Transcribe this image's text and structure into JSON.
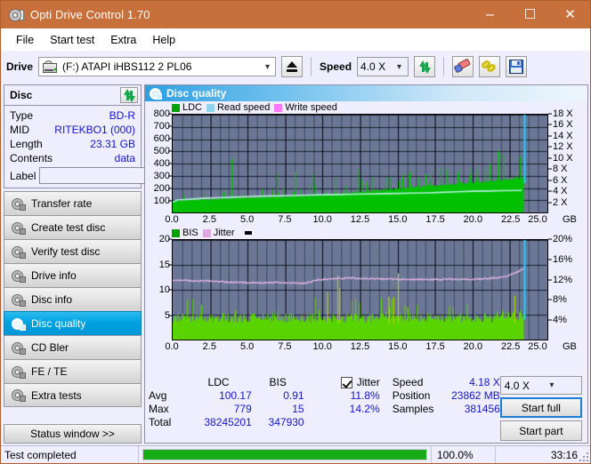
{
  "window": {
    "title": "Opti Drive Control 1.70",
    "icon": "disc-icon",
    "minimize": "–",
    "maximize": "☐",
    "close": "✕"
  },
  "menu": [
    "File",
    "Start test",
    "Extra",
    "Help"
  ],
  "toolbar": {
    "drive_label": "Drive",
    "drive_value": "(F:)   ATAPI iHBS112  2 PL06",
    "eject_title": "Eject",
    "speed_label": "Speed",
    "speed_value": "4.0 X",
    "buttons": [
      "refresh-icon",
      "erase-icon",
      "chain-icon",
      "save-icon"
    ]
  },
  "disc": {
    "title": "Disc",
    "refresh_icon": "refresh-icon",
    "rows": [
      {
        "key": "Type",
        "value": "BD-R"
      },
      {
        "key": "MID",
        "value": "RITEKBO1 (000)"
      },
      {
        "key": "Length",
        "value": "23.31 GB"
      },
      {
        "key": "Contents",
        "value": "data"
      }
    ],
    "label_key": "Label",
    "label_value": "",
    "label_placeholder": "",
    "cd_icon": "cd-icon"
  },
  "nav": {
    "items": [
      {
        "label": "Transfer rate",
        "active": false
      },
      {
        "label": "Create test disc",
        "active": false
      },
      {
        "label": "Verify test disc",
        "active": false
      },
      {
        "label": "Drive info",
        "active": false
      },
      {
        "label": "Disc info",
        "active": false
      },
      {
        "label": "Disc quality",
        "active": true
      },
      {
        "label": "CD Bler",
        "active": false
      },
      {
        "label": "FE / TE",
        "active": false
      },
      {
        "label": "Extra tests",
        "active": false
      }
    ],
    "status_window": "Status window >>"
  },
  "panel": {
    "title": "Disc quality",
    "icon": "disc-quality-icon"
  },
  "chart_data": [
    {
      "type": "area",
      "name": "ldc-chart",
      "title": "",
      "xlabel": "GB",
      "ylabel": "",
      "xlim": [
        0,
        25.0
      ],
      "ylim": [
        0,
        800
      ],
      "y2lim": [
        0,
        18
      ],
      "y2label": "X",
      "grid": true,
      "legend_position": "top-left",
      "legend": [
        {
          "label": "LDC",
          "color": "#00b400"
        },
        {
          "label": "Read speed",
          "color": "#8fd4f0"
        },
        {
          "label": "Write speed",
          "color": "#ff77ff"
        }
      ],
      "xticks": [
        "0.0",
        "2.5",
        "5.0",
        "7.5",
        "10.0",
        "12.5",
        "15.0",
        "17.5",
        "20.0",
        "22.5",
        "25.0"
      ],
      "yticks": [
        100,
        200,
        300,
        400,
        500,
        600,
        700,
        800
      ],
      "y2ticks": [
        2,
        4,
        6,
        8,
        10,
        12,
        14,
        16,
        18
      ],
      "data_end_x": 23.4,
      "series": [
        {
          "name": "LDC",
          "color": "#00b400",
          "kind": "area",
          "baseline": [
            [
              0.0,
              110
            ],
            [
              0.4,
              120
            ],
            [
              0.5,
              455
            ],
            [
              0.6,
              125
            ],
            [
              1.0,
              130
            ],
            [
              1.5,
              140
            ],
            [
              2.0,
              150
            ],
            [
              2.4,
              160
            ],
            [
              2.6,
              330
            ],
            [
              2.8,
              160
            ],
            [
              3.2,
              165
            ],
            [
              3.5,
              300
            ],
            [
              3.7,
              575
            ],
            [
              3.85,
              585
            ],
            [
              4.0,
              420
            ],
            [
              4.2,
              430
            ],
            [
              4.4,
              180
            ],
            [
              4.8,
              175
            ],
            [
              5.3,
              405
            ],
            [
              5.5,
              190
            ],
            [
              6.0,
              185
            ],
            [
              6.6,
              200
            ],
            [
              6.9,
              375
            ],
            [
              7.2,
              195
            ],
            [
              7.6,
              190
            ],
            [
              8.0,
              200
            ],
            [
              8.2,
              540
            ],
            [
              8.5,
              205
            ],
            [
              9.0,
              215
            ],
            [
              9.3,
              320
            ],
            [
              9.6,
              230
            ],
            [
              10.0,
              250
            ],
            [
              10.3,
              620
            ],
            [
              10.6,
              270
            ],
            [
              11.0,
              280
            ],
            [
              11.5,
              450
            ],
            [
              11.8,
              300
            ],
            [
              12.2,
              400
            ],
            [
              12.5,
              290
            ],
            [
              13.0,
              300
            ],
            [
              13.4,
              440
            ],
            [
              13.8,
              310
            ],
            [
              14.2,
              300
            ],
            [
              14.6,
              330
            ],
            [
              15.0,
              320
            ],
            [
              15.4,
              350
            ],
            [
              15.8,
              330
            ],
            [
              16.2,
              340
            ],
            [
              16.6,
              350
            ],
            [
              17.0,
              360
            ],
            [
              17.5,
              350
            ],
            [
              18.0,
              370
            ],
            [
              18.5,
              380
            ],
            [
              19.0,
              370
            ],
            [
              19.5,
              400
            ],
            [
              20.0,
              390
            ],
            [
              20.5,
              440
            ],
            [
              21.0,
              420
            ],
            [
              21.5,
              480
            ],
            [
              22.0,
              520
            ],
            [
              22.4,
              700
            ],
            [
              22.8,
              600
            ],
            [
              23.1,
              780
            ],
            [
              23.35,
              560
            ]
          ]
        },
        {
          "name": "Read speed",
          "color": "#b4f0dc",
          "kind": "line",
          "axis": "y2",
          "points": [
            [
              0.0,
              1.9
            ],
            [
              0.3,
              2.3
            ],
            [
              1.0,
              2.4
            ],
            [
              2.0,
              2.6
            ],
            [
              3.0,
              2.7
            ],
            [
              4.0,
              2.8
            ],
            [
              5.0,
              2.9
            ],
            [
              6.0,
              3.0
            ],
            [
              7.0,
              3.05
            ],
            [
              8.0,
              3.1
            ],
            [
              9.0,
              3.2
            ],
            [
              10.0,
              3.25
            ],
            [
              11.0,
              3.3
            ],
            [
              12.0,
              3.35
            ],
            [
              13.0,
              3.4
            ],
            [
              14.0,
              3.45
            ],
            [
              15.0,
              3.5
            ],
            [
              16.0,
              3.55
            ],
            [
              17.0,
              3.6
            ],
            [
              18.0,
              3.7
            ],
            [
              19.0,
              3.8
            ],
            [
              20.0,
              3.9
            ],
            [
              21.0,
              3.95
            ],
            [
              22.0,
              4.0
            ],
            [
              23.3,
              4.05
            ]
          ]
        }
      ],
      "marker_line": {
        "x": 23.4,
        "color": "#22c8f8"
      }
    },
    {
      "type": "area",
      "name": "bis-jitter-chart",
      "title": "",
      "xlabel": "GB",
      "ylabel": "",
      "xlim": [
        0,
        25.0
      ],
      "ylim": [
        0,
        20
      ],
      "y2lim": [
        0,
        20
      ],
      "y2label": "%",
      "grid": true,
      "legend_position": "top-left",
      "legend": [
        {
          "label": "BIS",
          "color": "#00b400"
        },
        {
          "label": "Jitter",
          "color": "#e0a8e0"
        }
      ],
      "xticks": [
        "0.0",
        "2.5",
        "5.0",
        "7.5",
        "10.0",
        "12.5",
        "15.0",
        "17.5",
        "20.0",
        "22.5",
        "25.0"
      ],
      "yticks": [
        5,
        10,
        15,
        20
      ],
      "y2ticks": [
        "4%",
        "8%",
        "12%",
        "16%",
        "20%"
      ],
      "data_end_x": 23.4,
      "series": [
        {
          "name": "BIS",
          "color": "#5ad400",
          "kind": "area",
          "avg": 4.2,
          "max": 15
        },
        {
          "name": "Jitter",
          "color": "#e6b8e6",
          "kind": "line",
          "points": [
            [
              0.0,
              11.95
            ],
            [
              0.5,
              11.9
            ],
            [
              1.0,
              11.85
            ],
            [
              1.5,
              11.8
            ],
            [
              2.0,
              11.8
            ],
            [
              2.5,
              11.75
            ],
            [
              3.0,
              11.7
            ],
            [
              3.5,
              11.6
            ],
            [
              4.0,
              11.5
            ],
            [
              4.5,
              11.45
            ],
            [
              5.0,
              11.4
            ],
            [
              5.5,
              11.4
            ],
            [
              6.0,
              11.4
            ],
            [
              6.5,
              11.45
            ],
            [
              7.0,
              11.5
            ],
            [
              7.5,
              11.4
            ],
            [
              8.0,
              11.35
            ],
            [
              8.5,
              11.3
            ],
            [
              9.0,
              11.4
            ],
            [
              9.5,
              11.9
            ],
            [
              10.0,
              12.1
            ],
            [
              10.5,
              12.2
            ],
            [
              11.0,
              12.25
            ],
            [
              11.5,
              12.3
            ],
            [
              12.0,
              12.35
            ],
            [
              12.5,
              12.3
            ],
            [
              13.0,
              12.25
            ],
            [
              13.5,
              12.2
            ],
            [
              14.0,
              12.2
            ],
            [
              14.5,
              12.15
            ],
            [
              15.0,
              12.1
            ],
            [
              16.0,
              12.1
            ],
            [
              17.0,
              12.1
            ],
            [
              18.0,
              12.1
            ],
            [
              19.0,
              12.1
            ],
            [
              20.0,
              12.1
            ],
            [
              21.0,
              12.2
            ],
            [
              21.8,
              12.5
            ],
            [
              22.3,
              12.8
            ],
            [
              22.8,
              13.3
            ],
            [
              23.2,
              13.9
            ],
            [
              23.35,
              14.1
            ]
          ]
        }
      ],
      "marker_line": {
        "x": 23.4,
        "color": "#22c8f8"
      }
    }
  ],
  "stats": {
    "columns": [
      "LDC",
      "BIS"
    ],
    "jitter_label": "Jitter",
    "jitter_checked": true,
    "rows": [
      {
        "label": "Avg",
        "ldc": "100.17",
        "bis": "0.91",
        "jitter": "11.8%"
      },
      {
        "label": "Max",
        "ldc": "779",
        "bis": "15",
        "jitter": "14.2%"
      },
      {
        "label": "Total",
        "ldc": "38245201",
        "bis": "347930",
        "jitter": ""
      }
    ],
    "info": [
      {
        "key": "Speed",
        "value": "4.18 X"
      },
      {
        "key": "Position",
        "value": "23862 MB"
      },
      {
        "key": "Samples",
        "value": "381456"
      }
    ],
    "speed_select": "4.0 X",
    "start_full": "Start full",
    "start_part": "Start part"
  },
  "statusbar": {
    "message": "Test completed",
    "progress_percent": 100,
    "percent_text": "100.0%",
    "elapsed": "33:16"
  },
  "colors": {
    "titlebar": "#c8703c",
    "accent_blue": "#00a2e0",
    "value_blue": "#1414c8",
    "plot_bg": "#6b7795",
    "ldc_green": "#00b400",
    "bis_green": "#5ad400",
    "jitter_pink": "#e6b8e6",
    "read_speed": "#b4f0dc",
    "marker_cyan": "#22c8f8",
    "progress_green": "#17ab17",
    "panel_bg": "#eeeeff"
  }
}
